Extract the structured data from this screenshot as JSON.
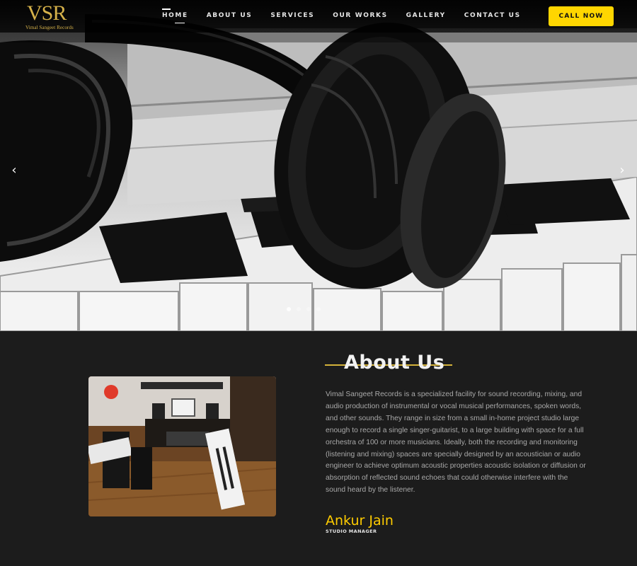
{
  "brand": {
    "logo_text": "VSR",
    "logo_subtitle": "Vimal Sangeet Records",
    "accent_color": "#ffd600",
    "gold_color": "#d6b24a"
  },
  "nav": {
    "items": [
      {
        "label": "HOME",
        "active": true
      },
      {
        "label": "ABOUT US",
        "active": false
      },
      {
        "label": "SERVICES",
        "active": false
      },
      {
        "label": "OUR WORKS",
        "active": false
      },
      {
        "label": "GALLERY",
        "active": false
      },
      {
        "label": "CONTACT US",
        "active": false
      }
    ],
    "cta_label": "CALL NOW"
  },
  "hero": {
    "image": "headphones-on-piano-keys",
    "prev_icon": "chevron-left-icon",
    "next_icon": "chevron-right-icon",
    "prev_glyph": "‹",
    "next_glyph": "›",
    "slide_count": 4,
    "active_slide": 1
  },
  "about": {
    "title": "About Us",
    "image": "studio-photo",
    "paragraph": "Vimal Sangeet Records is a specialized facility for sound recording, mixing, and audio production of instrumental or vocal musical performances, spoken words, and other sounds. They range in size from a small in-home project studio large enough to record a single singer-guitarist, to a large building with space for a full orchestra of 100 or more musicians. Ideally, both the recording and monitoring (listening and mixing) spaces are specially designed by an acoustician or audio engineer to achieve optimum acoustic properties acoustic isolation or diffusion or absorption of reflected sound echoes that could otherwise interfere with the sound heard by the listener.",
    "person_name": "Ankur Jain",
    "person_role": "STUDIO MANAGER"
  }
}
